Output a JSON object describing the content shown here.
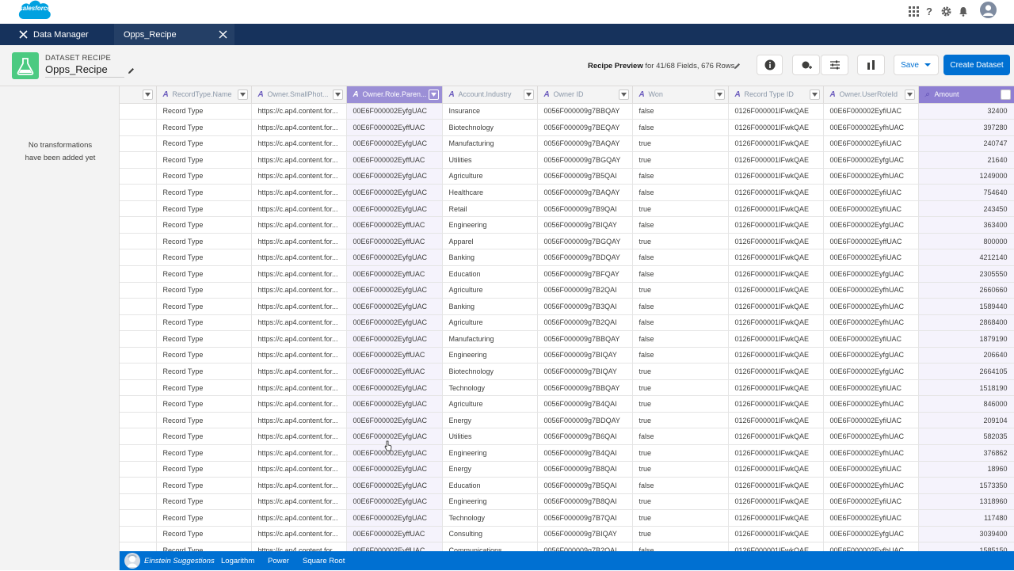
{
  "app": {
    "logo_text": "salesforce"
  },
  "tabs": {
    "data_manager": "Data Manager",
    "recipe": "Opps_Recipe"
  },
  "header": {
    "type_label": "DATASET RECIPE",
    "recipe_name": "Opps_Recipe",
    "preview_title": "Recipe Preview",
    "preview_detail": "for 41/68 Fields, 676 Rows",
    "save_label": "Save",
    "create_label": "Create Dataset"
  },
  "sidebar": {
    "empty_line1": "No transformations",
    "empty_line2": "have been added yet"
  },
  "grid": {
    "columns": [
      "",
      "RecordType.Name",
      "Owner.SmallPhot...",
      "Owner.Role.Paren...",
      "Account.Industry",
      "Owner ID",
      "Won",
      "Record Type ID",
      "Owner.UserRoleId",
      "Amount"
    ],
    "rows": [
      [
        "Record Type",
        "https://c.ap4.content.for...",
        "00E6F000002EyfgUAC",
        "Insurance",
        "0056F000009g7BBQAY",
        "false",
        "0126F000001IFwkQAE",
        "00E6F000002EyfiUAC",
        "32400"
      ],
      [
        "Record Type",
        "https://c.ap4.content.for...",
        "00E6F000002EyffUAC",
        "Biotechnology",
        "0056F000009g7BEQAY",
        "false",
        "0126F000001IFwkQAE",
        "00E6F000002EyfhUAC",
        "397280"
      ],
      [
        "Record Type",
        "https://c.ap4.content.for...",
        "00E6F000002EyfgUAC",
        "Manufacturing",
        "0056F000009g7BAQAY",
        "true",
        "0126F000001IFwkQAE",
        "00E6F000002EyfiUAC",
        "240747"
      ],
      [
        "Record Type",
        "https://c.ap4.content.for...",
        "00E6F000002EyffUAC",
        "Utilities",
        "0056F000009g7BGQAY",
        "true",
        "0126F000001IFwkQAE",
        "00E6F000002EyfgUAC",
        "21640"
      ],
      [
        "Record Type",
        "https://c.ap4.content.for...",
        "00E6F000002EyfgUAC",
        "Agriculture",
        "0056F000009g7B5QAI",
        "false",
        "0126F000001IFwkQAE",
        "00E6F000002EyfhUAC",
        "1249000"
      ],
      [
        "Record Type",
        "https://c.ap4.content.for...",
        "00E6F000002EyfgUAC",
        "Healthcare",
        "0056F000009g7BAQAY",
        "false",
        "0126F000001IFwkQAE",
        "00E6F000002EyfiUAC",
        "754640"
      ],
      [
        "Record Type",
        "https://c.ap4.content.for...",
        "00E6F000002EyfgUAC",
        "Retail",
        "0056F000009g7B9QAI",
        "true",
        "0126F000001IFwkQAE",
        "00E6F000002EyfiUAC",
        "243450"
      ],
      [
        "Record Type",
        "https://c.ap4.content.for...",
        "00E6F000002EyffUAC",
        "Engineering",
        "0056F000009g7BIQAY",
        "false",
        "0126F000001IFwkQAE",
        "00E6F000002EyfgUAC",
        "363400"
      ],
      [
        "Record Type",
        "https://c.ap4.content.for...",
        "00E6F000002EyffUAC",
        "Apparel",
        "0056F000009g7BGQAY",
        "true",
        "0126F000001IFwkQAE",
        "00E6F000002EyffUAC",
        "800000"
      ],
      [
        "Record Type",
        "https://c.ap4.content.for...",
        "00E6F000002EyfgUAC",
        "Banking",
        "0056F000009g7BDQAY",
        "false",
        "0126F000001IFwkQAE",
        "00E6F000002EyfiUAC",
        "4212140"
      ],
      [
        "Record Type",
        "https://c.ap4.content.for...",
        "00E6F000002EyffUAC",
        "Education",
        "0056F000009g7BFQAY",
        "false",
        "0126F000001IFwkQAE",
        "00E6F000002EyfgUAC",
        "2305550"
      ],
      [
        "Record Type",
        "https://c.ap4.content.for...",
        "00E6F000002EyfgUAC",
        "Agriculture",
        "0056F000009g7B2QAI",
        "true",
        "0126F000001IFwkQAE",
        "00E6F000002EyfhUAC",
        "2660660"
      ],
      [
        "Record Type",
        "https://c.ap4.content.for...",
        "00E6F000002EyfgUAC",
        "Banking",
        "0056F000009g7B3QAI",
        "false",
        "0126F000001IFwkQAE",
        "00E6F000002EyfhUAC",
        "1589440"
      ],
      [
        "Record Type",
        "https://c.ap4.content.for...",
        "00E6F000002EyfgUAC",
        "Agriculture",
        "0056F000009g7B2QAI",
        "false",
        "0126F000001IFwkQAE",
        "00E6F000002EyfhUAC",
        "2868400"
      ],
      [
        "Record Type",
        "https://c.ap4.content.for...",
        "00E6F000002EyfgUAC",
        "Manufacturing",
        "0056F000009g7BBQAY",
        "false",
        "0126F000001IFwkQAE",
        "00E6F000002EyfiUAC",
        "1879190"
      ],
      [
        "Record Type",
        "https://c.ap4.content.for...",
        "00E6F000002EyffUAC",
        "Engineering",
        "0056F000009g7BIQAY",
        "false",
        "0126F000001IFwkQAE",
        "00E6F000002EyfgUAC",
        "206640"
      ],
      [
        "Record Type",
        "https://c.ap4.content.for...",
        "00E6F000002EyffUAC",
        "Biotechnology",
        "0056F000009g7BIQAY",
        "true",
        "0126F000001IFwkQAE",
        "00E6F000002EyfgUAC",
        "2664105"
      ],
      [
        "Record Type",
        "https://c.ap4.content.for...",
        "00E6F000002EyfgUAC",
        "Technology",
        "0056F000009g7BBQAY",
        "true",
        "0126F000001IFwkQAE",
        "00E6F000002EyfiUAC",
        "1518190"
      ],
      [
        "Record Type",
        "https://c.ap4.content.for...",
        "00E6F000002EyfgUAC",
        "Agriculture",
        "0056F000009g7B4QAI",
        "true",
        "0126F000001IFwkQAE",
        "00E6F000002EyfhUAC",
        "846000"
      ],
      [
        "Record Type",
        "https://c.ap4.content.for...",
        "00E6F000002EyfgUAC",
        "Energy",
        "0056F000009g7BDQAY",
        "true",
        "0126F000001IFwkQAE",
        "00E6F000002EyfiUAC",
        "209104"
      ],
      [
        "Record Type",
        "https://c.ap4.content.for...",
        "00E6F000002EyfgUAC",
        "Utilities",
        "0056F000009g7B6QAI",
        "false",
        "0126F000001IFwkQAE",
        "00E6F000002EyfhUAC",
        "582035"
      ],
      [
        "Record Type",
        "https://c.ap4.content.for...",
        "00E6F000002EyfgUAC",
        "Engineering",
        "0056F000009g7B4QAI",
        "true",
        "0126F000001IFwkQAE",
        "00E6F000002EyfhUAC",
        "376862"
      ],
      [
        "Record Type",
        "https://c.ap4.content.for...",
        "00E6F000002EyfgUAC",
        "Energy",
        "0056F000009g7B8QAI",
        "true",
        "0126F000001IFwkQAE",
        "00E6F000002EyfiUAC",
        "18960"
      ],
      [
        "Record Type",
        "https://c.ap4.content.for...",
        "00E6F000002EyfgUAC",
        "Education",
        "0056F000009g7B5QAI",
        "false",
        "0126F000001IFwkQAE",
        "00E6F000002EyfhUAC",
        "1573350"
      ],
      [
        "Record Type",
        "https://c.ap4.content.for...",
        "00E6F000002EyfgUAC",
        "Engineering",
        "0056F000009g7B8QAI",
        "true",
        "0126F000001IFwkQAE",
        "00E6F000002EyfiUAC",
        "1318960"
      ],
      [
        "Record Type",
        "https://c.ap4.content.for...",
        "00E6F000002EyfgUAC",
        "Technology",
        "0056F000009g7B7QAI",
        "true",
        "0126F000001IFwkQAE",
        "00E6F000002EyfiUAC",
        "117480"
      ],
      [
        "Record Type",
        "https://c.ap4.content.for...",
        "00E6F000002EyffUAC",
        "Consulting",
        "0056F000009g7BIQAY",
        "true",
        "0126F000001IFwkQAE",
        "00E6F000002EyfgUAC",
        "3039400"
      ],
      [
        "Record Type",
        "https://c.ap4.content.for...",
        "00E6F000002EyffUAC",
        "Communications",
        "0056F000009g7B2QAI",
        "false",
        "0126F000001IFwkQAE",
        "00E6F000002EyfhUAC",
        "1585150"
      ]
    ]
  },
  "einstein": {
    "label": "Einstein Suggestions",
    "items": [
      "Logarithm",
      "Power",
      "Square Root"
    ]
  },
  "colors": {
    "brand": "#0070d2",
    "nav": "#16325c",
    "selected_column": "#9b8fd6",
    "recipe_icon": "#4bca81"
  }
}
